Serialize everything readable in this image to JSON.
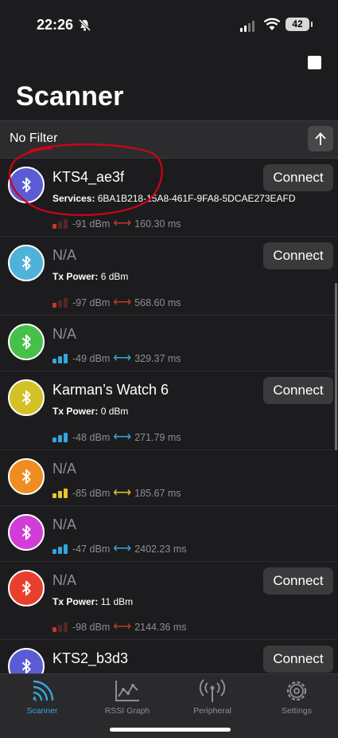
{
  "status": {
    "time": "22:26",
    "battery": "42"
  },
  "title": "Scanner",
  "filter": {
    "label": "No Filter"
  },
  "devices": [
    {
      "name": "KTS4_ae3f",
      "named": true,
      "detail_label": "Services:",
      "detail_value": "6BA1B218-15A8-461F-9FA8-5DCAE273EAFD",
      "rssi": "-91 dBm",
      "interval": "160.30 ms",
      "connect": "Connect",
      "color": "#5b5bd6",
      "signal": "#c0392b"
    },
    {
      "name": "N/A",
      "named": false,
      "detail_label": "Tx Power:",
      "detail_value": "6 dBm",
      "rssi": "-97 dBm",
      "interval": "568.60 ms",
      "connect": "Connect",
      "color": "#4fb2d9",
      "signal": "#c0392b"
    },
    {
      "name": "N/A",
      "named": false,
      "detail_label": "",
      "detail_value": "",
      "rssi": "-49 dBm",
      "interval": "329.37 ms",
      "connect": "",
      "color": "#47c04a",
      "signal": "#34a7d8"
    },
    {
      "name": "Karman’s Watch 6",
      "named": true,
      "detail_label": "Tx Power:",
      "detail_value": "0 dBm",
      "rssi": "-48 dBm",
      "interval": "271.79 ms",
      "connect": "Connect",
      "color": "#d4c125",
      "signal": "#34a7d8"
    },
    {
      "name": "N/A",
      "named": false,
      "detail_label": "",
      "detail_value": "",
      "rssi": "-85 dBm",
      "interval": "185.67 ms",
      "connect": "",
      "color": "#ef8c22",
      "signal": "#e8c232"
    },
    {
      "name": "N/A",
      "named": false,
      "detail_label": "",
      "detail_value": "",
      "rssi": "-47 dBm",
      "interval": "2402.23 ms",
      "connect": "",
      "color": "#d23dd8",
      "signal": "#34a7d8"
    },
    {
      "name": "N/A",
      "named": false,
      "detail_label": "Tx Power:",
      "detail_value": "11 dBm",
      "rssi": "-98 dBm",
      "interval": "2144.36 ms",
      "connect": "Connect",
      "color": "#e8402c",
      "signal": "#c0392b"
    },
    {
      "name": "KTS2_b3d3",
      "named": true,
      "detail_label": "",
      "detail_value": "",
      "rssi": "",
      "interval": "",
      "connect": "Connect",
      "color": "#5b5bd6",
      "signal": "#c0392b"
    }
  ],
  "tabs": [
    {
      "label": "Scanner",
      "icon": "scanner-waves-icon",
      "active": true
    },
    {
      "label": "RSSI Graph",
      "icon": "line-graph-icon",
      "active": false
    },
    {
      "label": "Peripheral",
      "icon": "antenna-icon",
      "active": false
    },
    {
      "label": "Settings",
      "icon": "gear-icon",
      "active": false
    }
  ],
  "colors": {
    "accent": "#34a7d8",
    "background": "#1c1c1e",
    "annotation": "#d0021b"
  }
}
